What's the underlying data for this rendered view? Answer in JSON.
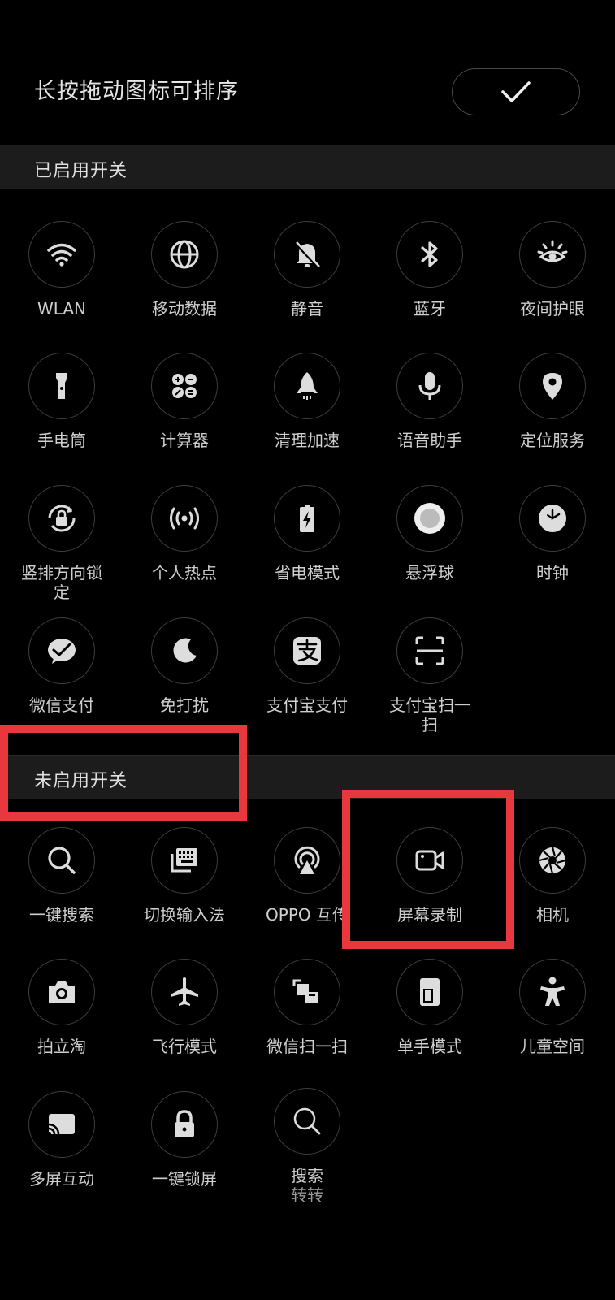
{
  "header": {
    "title": "长按拖动图标可排序"
  },
  "enabled": {
    "title": "已启用开关",
    "items": [
      {
        "label": "WLAN",
        "icon": "wifi-icon"
      },
      {
        "label": "移动数据",
        "icon": "globe-icon"
      },
      {
        "label": "静音",
        "icon": "bell-mute-icon"
      },
      {
        "label": "蓝牙",
        "icon": "bluetooth-icon"
      },
      {
        "label": "夜间护眼",
        "icon": "eye-icon"
      },
      {
        "label": "手电筒",
        "icon": "flashlight-icon"
      },
      {
        "label": "计算器",
        "icon": "calculator-icon"
      },
      {
        "label": "清理加速",
        "icon": "rocket-icon"
      },
      {
        "label": "语音助手",
        "icon": "microphone-icon"
      },
      {
        "label": "定位服务",
        "icon": "location-pin-icon"
      },
      {
        "label": "竖排方向锁定",
        "icon": "rotation-lock-icon"
      },
      {
        "label": "个人热点",
        "icon": "hotspot-icon"
      },
      {
        "label": "省电模式",
        "icon": "battery-saver-icon"
      },
      {
        "label": "悬浮球",
        "icon": "floating-ball-icon"
      },
      {
        "label": "时钟",
        "icon": "clock-icon"
      },
      {
        "label": "微信支付",
        "icon": "wechat-pay-icon"
      },
      {
        "label": "免打扰",
        "icon": "moon-icon"
      },
      {
        "label": "支付宝支付",
        "icon": "alipay-icon"
      },
      {
        "label": "支付宝扫一扫",
        "icon": "scan-frame-icon"
      }
    ]
  },
  "disabled": {
    "title": "未启用开关",
    "items": [
      {
        "label": "一键搜索",
        "icon": "search-icon"
      },
      {
        "label": "切换输入法",
        "icon": "keyboard-icon"
      },
      {
        "label": "OPPO 互传",
        "icon": "share-transfer-icon"
      },
      {
        "label": "屏幕录制",
        "icon": "video-camera-icon"
      },
      {
        "label": "相机",
        "icon": "camera-shutter-icon"
      },
      {
        "label": "拍立淘",
        "icon": "camera-icon"
      },
      {
        "label": "飞行模式",
        "icon": "airplane-icon"
      },
      {
        "label": "微信扫一扫",
        "icon": "wechat-scan-icon"
      },
      {
        "label": "单手模式",
        "icon": "one-hand-icon"
      },
      {
        "label": "儿童空间",
        "icon": "child-icon"
      },
      {
        "label": "多屏互动",
        "icon": "cast-icon"
      },
      {
        "label": "一键锁屏",
        "icon": "lock-icon"
      },
      {
        "label": "搜索",
        "sublabel": "转转",
        "icon": "search-icon"
      }
    ]
  },
  "colors": {
    "background": "#000000",
    "highlight": "#e8373d",
    "section": "#1c1c1c"
  }
}
